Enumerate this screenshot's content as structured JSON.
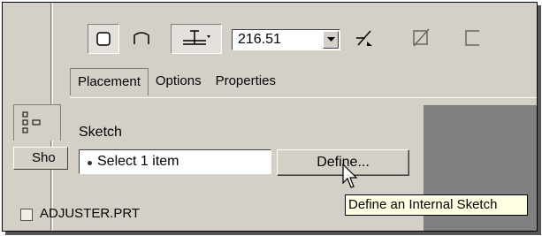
{
  "toolbar": {
    "value": "216.51",
    "icons": [
      "solid-icon",
      "surface-icon",
      "depth-options-icon",
      "dropdown-arrow-icon",
      "flip-direction-icon",
      "remove-material-icon",
      "thicken-icon"
    ]
  },
  "tabs": [
    {
      "label": "Placement",
      "active": true
    },
    {
      "label": "Options",
      "active": false
    },
    {
      "label": "Properties",
      "active": false
    }
  ],
  "panel": {
    "sketch_label": "Sketch",
    "collector_text": "Select 1 item",
    "define_label": "Define..."
  },
  "tooltip": "Define an Internal Sketch",
  "navigator": {
    "show_label": "Sho",
    "tree_item": "ADJUSTER.PRT"
  },
  "colors": {
    "face": "#d4d0c8",
    "tooltip_bg": "#ffffe1",
    "dark": "#808080"
  }
}
